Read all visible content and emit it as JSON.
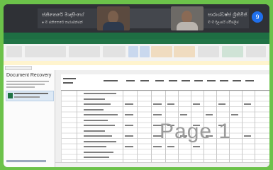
{
  "meeting": {
    "participant_1": {
      "name": "ජනිතෙරේ මාදාසිංහේ",
      "sub": "● ✆ ජනිතෙරේ තාරාජ්න්ජන්"
    },
    "participant_2": {
      "name": "පාරාශ්වෂ්ජ ශ්‍රිතිමිජ්",
      "sub": "✆ ✆ දිලාර්ජ් ශ්ඵ‍ිජල‍ිජ"
    },
    "more_badge": "9"
  },
  "excel": {
    "recovery_title": "Document Recovery",
    "watermark": "Page 1"
  },
  "colors": {
    "frame_green": "#6cc24a",
    "excel_green": "#217346",
    "meeting_bg": "#2f3136",
    "badge_blue": "#1f6feb"
  }
}
